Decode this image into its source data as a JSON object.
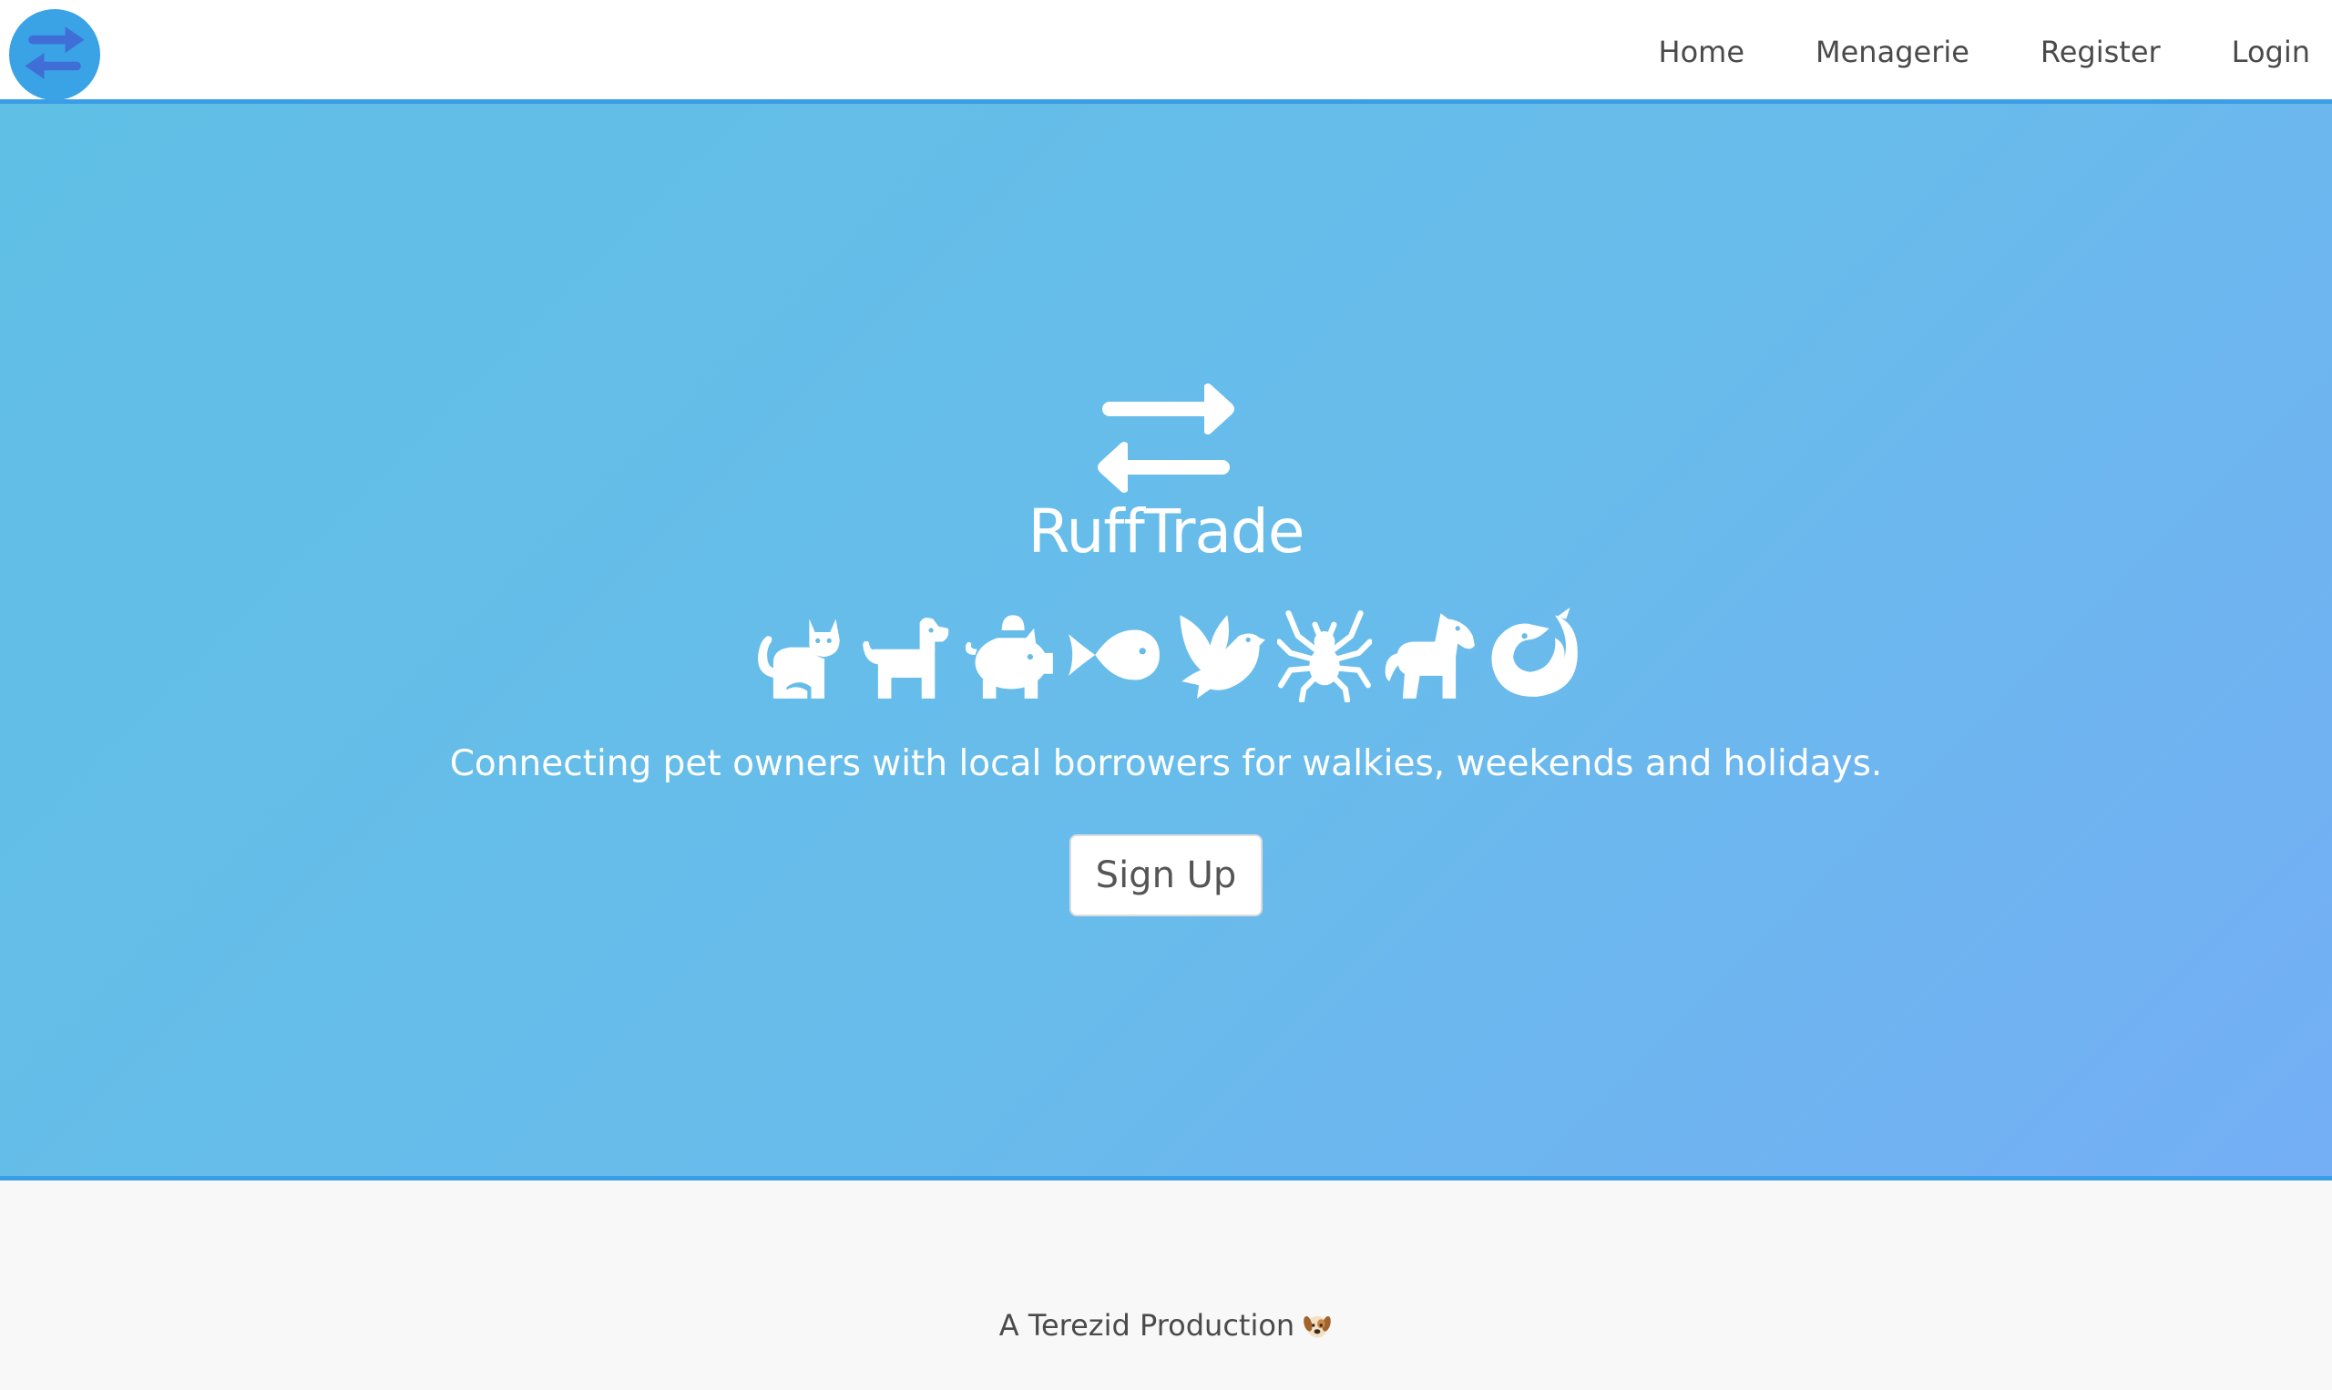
{
  "navbar": {
    "logo_icon": "swap-arrows-icon",
    "links": [
      {
        "label": "Home"
      },
      {
        "label": "Menagerie"
      },
      {
        "label": "Register"
      },
      {
        "label": "Login"
      }
    ]
  },
  "hero": {
    "title": "RuffTrade",
    "tagline": "Connecting pet owners with local borrowers for walkies, weekends and holidays.",
    "signup_label": "Sign Up",
    "animal_icons": [
      "cat-icon",
      "dog-icon",
      "piggy-bank-icon",
      "fish-icon",
      "dove-icon",
      "spider-icon",
      "horse-icon",
      "shrimp-icon"
    ]
  },
  "footer": {
    "text": "A Terezid Production",
    "emoji_icon": "dog-face-icon"
  },
  "colors": {
    "accent": "#3a9ee6",
    "hero_gradient_start": "#60bfe5",
    "hero_gradient_end": "#74aef5",
    "nav_text": "#4a4a4a"
  }
}
